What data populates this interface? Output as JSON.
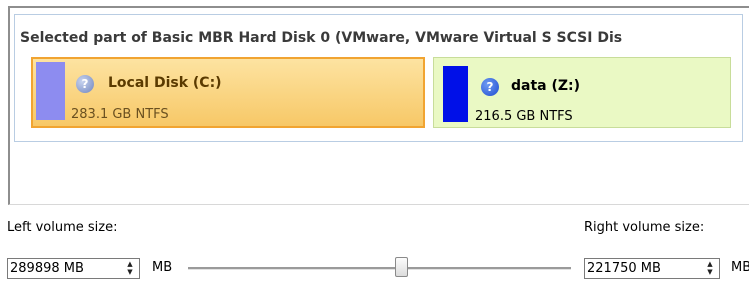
{
  "disk": {
    "title": "Selected part of Basic MBR Hard Disk 0 (VMware, VMware Virtual S SCSI Dis",
    "partitions": [
      {
        "name": "Local Disk (C:)",
        "size": "283.1 GB NTFS",
        "icon": "help-icon",
        "selected": true,
        "color": "#8d8cf0"
      },
      {
        "name": "data (Z:)",
        "size": "216.5 GB NTFS",
        "icon": "help-icon",
        "selected": false,
        "color": "#0010e8"
      }
    ]
  },
  "resize": {
    "left_label": "Left volume size:",
    "right_label": "Right volume size:",
    "left_value": "289898 MB",
    "right_value": "221750 MB",
    "left_unit": "MB",
    "right_unit": "MB",
    "slider_fraction": 0.557
  }
}
